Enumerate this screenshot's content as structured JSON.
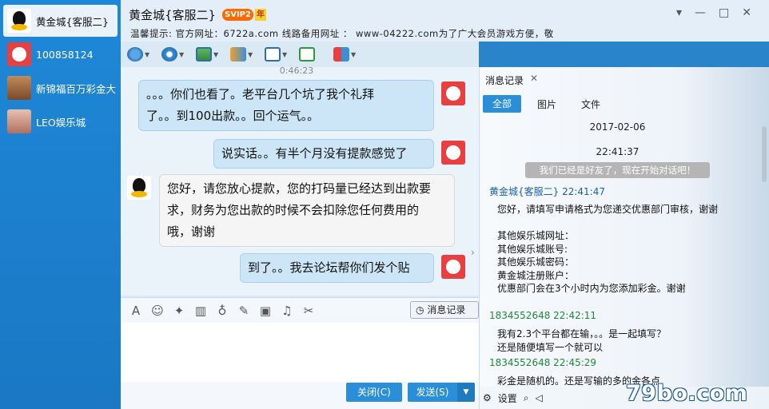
{
  "sidebar": {
    "contacts": [
      {
        "name": "黄金城{客服二}",
        "avatar": "qq-penguin-icon",
        "active": true
      },
      {
        "name": "100858124",
        "avatar": "dog-avatar-icon",
        "active": false
      },
      {
        "name": "新锦福百万彩金大",
        "avatar": "girl-avatar-icon",
        "active": false
      },
      {
        "name": "LEO娱乐城",
        "avatar": "leo-avatar-icon",
        "active": false
      }
    ]
  },
  "header": {
    "title": "黄金城{客服二}",
    "svip": "SVIP2",
    "year": "年",
    "notice": "温馨提示: 官方网址：6722a.com  线路备用网址 ： www-04222.com为了广大会员游戏方便，敬"
  },
  "window_controls": {
    "settings": "▾",
    "minimize": "—",
    "maximize": "□",
    "close": "✕"
  },
  "chat": {
    "time": "0:46:23",
    "messages": [
      {
        "side": "mine",
        "text_lines": [
          "。。。你们也看了。老平台几个坑了我个礼拜",
          "了。。到100出款。。回个运气。。"
        ]
      },
      {
        "side": "mine",
        "text_lines": [
          "说实话。。有半个月没有提款感觉了"
        ]
      },
      {
        "side": "theirs",
        "text_lines": [
          "您好，请您放心提款，您的打码量已经达到出款要",
          "求，财务为您出款的时候不会扣除您任何费用的",
          "哦，谢谢"
        ]
      },
      {
        "side": "mine",
        "text_lines": [
          "到了。。我去论坛帮你们发个贴"
        ]
      }
    ]
  },
  "input_toolbar": {
    "history_label": "消息记录"
  },
  "buttons": {
    "close": "关闭(C)",
    "send": "发送(S)"
  },
  "history": {
    "tab": "消息记录",
    "filters": {
      "all": "全部",
      "images": "图片",
      "files": "文件"
    },
    "date": "2017-02-06",
    "time": "22:41:37",
    "system_msg": "我们已经是好友了，现在开始对话吧！",
    "entries": [
      {
        "sender": "黄金城{客服二} 22:41:47",
        "lines": "您好，请填写申请格式为您递交优惠部门审核，谢谢\n\n其他娱乐城网址：\n其他娱乐城账号:\n其他娱乐城密码：\n黄金城注册账户：\n优惠部门会在3个小时内为您添加彩金。谢谢"
      },
      {
        "sender": "1834552648 22:42:11",
        "lines": "我有2.3个平台都在输，。。是一起填写？\n还是随便填写一个就可以"
      },
      {
        "sender": "1834552648 22:45:29",
        "lines": "彩金是随机的。还是写输的多的金各点"
      }
    ],
    "settings_label": "设置"
  },
  "watermark": "79bo.com"
}
